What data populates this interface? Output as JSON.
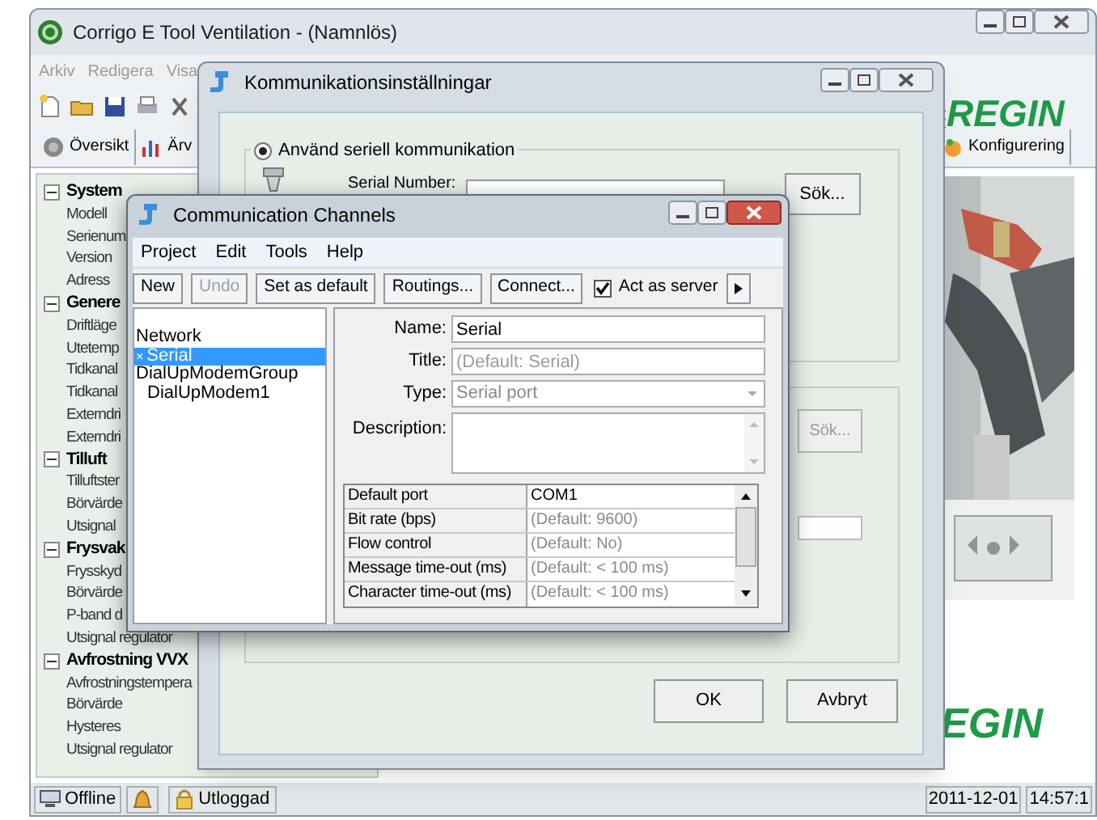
{
  "main_window": {
    "title": "Corrigo E Tool Ventilation - (Namnlös)",
    "menu": [
      {
        "label": "Arkiv",
        "disabled": true
      },
      {
        "label": "Redigera",
        "disabled": true
      },
      {
        "label": "Visa",
        "disabled": true
      }
    ],
    "tabs": [
      {
        "label": "Översikt"
      },
      {
        "label": "Ärv"
      },
      {
        "label": "Konfigurering"
      }
    ],
    "logo": "REGIN",
    "tree": [
      {
        "label": "System",
        "expanded": true,
        "children": [
          {
            "label": "Modell"
          },
          {
            "label": "Serienum"
          },
          {
            "label": "Version"
          },
          {
            "label": "Adress"
          }
        ]
      },
      {
        "label": "Genere",
        "expanded": true,
        "children": [
          {
            "label": "Driftläge"
          },
          {
            "label": "Utetemp"
          },
          {
            "label": "Tidkanal"
          },
          {
            "label": "Tidkanal"
          },
          {
            "label": "Externdri"
          },
          {
            "label": "Externdri"
          }
        ]
      },
      {
        "label": "Tilluft",
        "expanded": true,
        "children": [
          {
            "label": "Tilluftster"
          },
          {
            "label": "Börvärde"
          },
          {
            "label": "Utsignal"
          }
        ]
      },
      {
        "label": "Frysvak",
        "expanded": true,
        "children": [
          {
            "label": "Frysskyd"
          },
          {
            "label": "Börvärde"
          },
          {
            "label": "P-band d"
          },
          {
            "label": "Utsignal regulator"
          }
        ]
      },
      {
        "label": "Avfrostning VVX",
        "expanded": true,
        "children": [
          {
            "label": "Avfrostningstempera"
          },
          {
            "label": "Börvärde"
          },
          {
            "label": "Hysteres"
          },
          {
            "label": "Utsignal regulator"
          }
        ]
      }
    ],
    "bottom_logo": "EGIN",
    "status_bar": {
      "connection": "Offline",
      "login": "Utloggad",
      "date": "2011-12-01",
      "time": "14:57:1"
    }
  },
  "settings_dialog": {
    "title": "Kommunikationsinställningar",
    "serial_option": {
      "label": "Använd seriell kommunikation",
      "selected": true
    },
    "serial_number_label": "Serial Number:",
    "search_buttons": [
      {
        "label": "Sök...",
        "disabled": false
      },
      {
        "label": "Sök...",
        "disabled": true
      }
    ],
    "ok": "OK",
    "cancel": "Avbryt"
  },
  "channels_window": {
    "title": "Communication Channels",
    "menu": [
      "Project",
      "Edit",
      "Tools",
      "Help"
    ],
    "toolbar": [
      {
        "kind": "button",
        "label": "New",
        "disabled": false
      },
      {
        "kind": "button",
        "label": "Undo",
        "disabled": true
      },
      {
        "kind": "button",
        "label": "Set as default",
        "disabled": false
      },
      {
        "kind": "button",
        "label": "Routings...",
        "disabled": false
      },
      {
        "kind": "button",
        "label": "Connect...",
        "disabled": false
      },
      {
        "kind": "checkbox",
        "label": "Act as server",
        "checked": true
      },
      {
        "kind": "more"
      }
    ],
    "channels": [
      {
        "label": "Network",
        "selected": false
      },
      {
        "label": "Serial",
        "marker": "×",
        "selected": true
      },
      {
        "label": "DialUpModemGroup",
        "selected": false,
        "children": [
          {
            "label": "DialUpModem1",
            "selected": false
          }
        ]
      }
    ],
    "form": {
      "name_label": "Name:",
      "name": "Serial",
      "title_label": "Title:",
      "title_placeholder": "(Default: Serial)",
      "type_label": "Type:",
      "type": "Serial port",
      "type_disabled": true,
      "description_label": "Description:"
    },
    "properties": [
      {
        "name": "Default port",
        "value": "COM1",
        "is_default": false
      },
      {
        "name": "Bit rate (bps)",
        "value": "(Default: 9600)",
        "is_default": true
      },
      {
        "name": "Flow control",
        "value": "(Default: No)",
        "is_default": true
      },
      {
        "name": "Message time-out (ms)",
        "value": "(Default: < 100 ms)",
        "is_default": true
      },
      {
        "name": "Character time-out (ms)",
        "value": "(Default: < 100 ms)",
        "is_default": true
      }
    ]
  }
}
